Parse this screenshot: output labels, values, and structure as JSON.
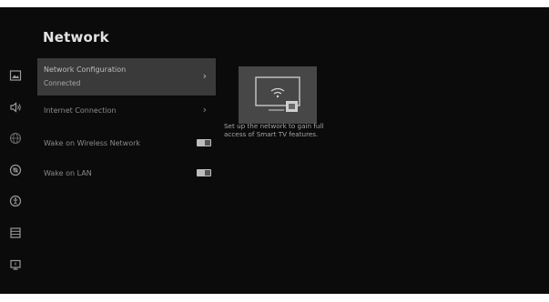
{
  "header": {
    "title": "Network"
  },
  "sidebar": {
    "icons": [
      {
        "name": "picture-icon"
      },
      {
        "name": "sound-icon"
      },
      {
        "name": "network-icon"
      },
      {
        "name": "general-icon"
      },
      {
        "name": "accessibility-icon"
      },
      {
        "name": "apps-icon"
      },
      {
        "name": "support-icon"
      }
    ],
    "active_index": 2
  },
  "menu": {
    "items": [
      {
        "label": "Network Configuration",
        "subtitle": "Connected",
        "type": "submenu",
        "selected": true
      },
      {
        "label": "Internet Connection",
        "type": "submenu",
        "selected": false
      },
      {
        "label": "Wake on Wireless Network",
        "type": "toggle",
        "on": true
      },
      {
        "label": "Wake on LAN",
        "type": "toggle",
        "on": true
      }
    ]
  },
  "info": {
    "icon": "wifi-tv-icon",
    "description": "Set up the network to gain full access of Smart TV features."
  },
  "colors": {
    "background": "#0b0b0b",
    "selected_row": "#3a3a3a",
    "text": "#8a8a8a",
    "title": "#e2e2e2"
  }
}
